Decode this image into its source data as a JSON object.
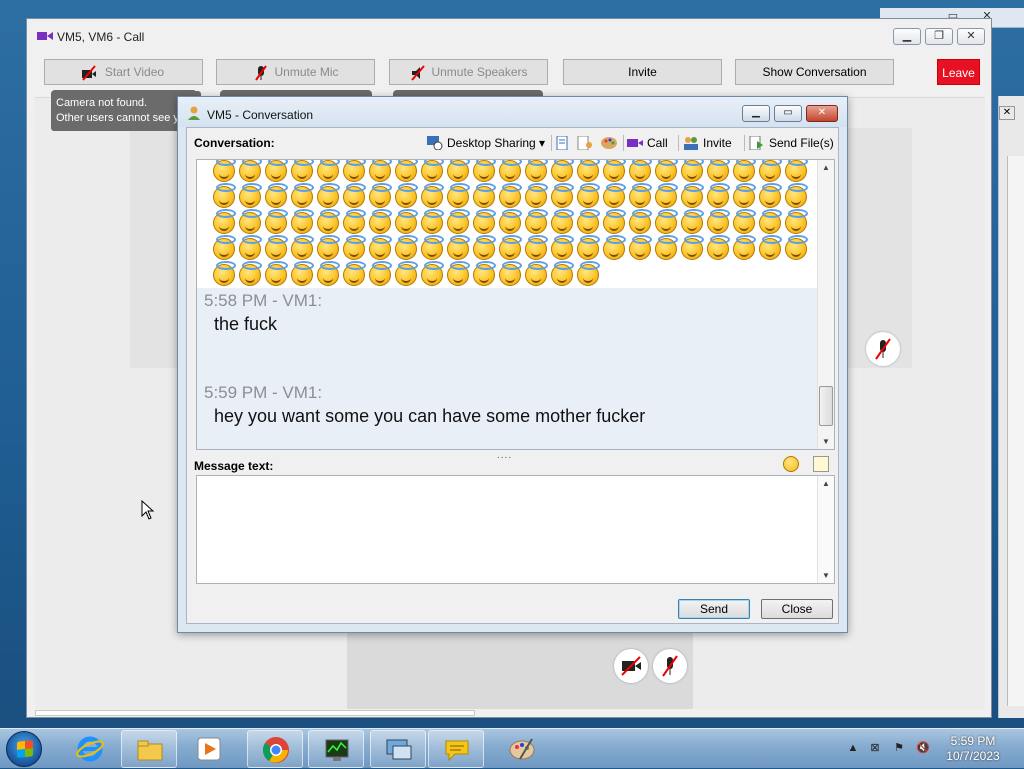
{
  "call_window": {
    "title": "VM5, VM6 - Call",
    "buttons": {
      "start_video": "Start Video",
      "unmute_mic": "Unmute Mic",
      "unmute_speakers": "Unmute Speakers",
      "invite": "Invite",
      "show_conversation": "Show Conversation",
      "leave": "Leave"
    },
    "tooltip_line1": "Camera not found.",
    "tooltip_line2": "Other users cannot see you.",
    "leave_color": "#e81123"
  },
  "conversation_window": {
    "title": "VM5 - Conversation",
    "conversation_label": "Conversation:",
    "toolbar": {
      "desktop_sharing": "Desktop Sharing",
      "call": "Call",
      "invite": "Invite",
      "send_files": "Send File(s)"
    },
    "emoji_rows": [
      {
        "count": 23
      },
      {
        "count": 23
      },
      {
        "count": 23
      },
      {
        "count": 23
      },
      {
        "count": 15
      }
    ],
    "emoji_icon": "smiling-face-with-halo-icon",
    "messages": [
      {
        "header": "5:58 PM - VM1:",
        "text": "the fuck"
      },
      {
        "header": "5:59 PM - VM1:",
        "text": "hey you want some you can have some mother fucker"
      }
    ],
    "splitter": "....",
    "message_text_label": "Message text:",
    "message_input_value": "",
    "send_label": "Send",
    "close_label": "Close"
  },
  "taskbar": {
    "apps": [
      "internet-explorer-icon",
      "file-explorer-icon",
      "media-player-icon",
      "chrome-icon",
      "task-manager-icon",
      "remote-desktop-icon",
      "chat-icon",
      "paint-icon"
    ],
    "clock_time": "5:59 PM",
    "clock_date": "10/7/2023",
    "tray_icons": [
      "show-hidden-icons-chevron",
      "network-error-icon",
      "flag-icon",
      "volume-muted-icon"
    ]
  }
}
